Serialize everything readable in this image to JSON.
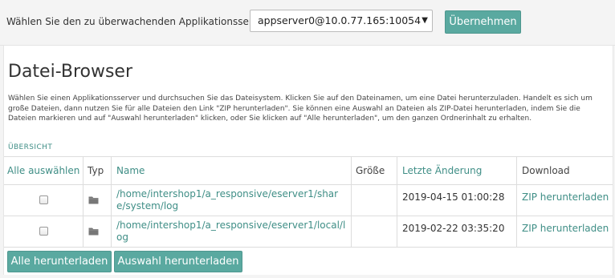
{
  "server_bar": {
    "label": "Wählen Sie den zu überwachenden Applikationsserver:",
    "selected_server": "appserver0@10.0.77.165:10054",
    "apply_label": "Übernehmen"
  },
  "page": {
    "title": "Datei-Browser",
    "description": "Wählen Sie einen Applikationsserver und durchsuchen Sie das Dateisystem. Klicken Sie auf den Dateinamen, um eine Datei herunterzuladen. Handelt es sich um große Dateien, dann nutzen Sie für alle Dateien den Link \"ZIP herunterladen\". Sie können eine Auswahl an Dateien als ZIP-Datei herunterladen, indem Sie die Dateien markieren und auf \"Auswahl herunterladen\" klicken, oder Sie klicken auf \"Alle herunterladen\", um den ganzen Ordnerinhalt zu erhalten.",
    "overview_link": "ÜBERSICHT"
  },
  "table": {
    "headers": {
      "select_all": "Alle auswählen",
      "type": "Typ",
      "name": "Name",
      "size": "Größe",
      "modified": "Letzte Änderung",
      "download": "Download"
    },
    "rows": [
      {
        "checked": false,
        "type_icon": "folder-icon",
        "name": "/home/intershop1/a_responsive/eserver1/share/system/log",
        "size": "",
        "modified": "2019-04-15 01:00:28",
        "download": "ZIP herunterladen"
      },
      {
        "checked": false,
        "type_icon": "folder-icon",
        "name": "/home/intershop1/a_responsive/eserver1/local/log",
        "size": "",
        "modified": "2019-02-22 03:35:20",
        "download": "ZIP herunterladen"
      }
    ]
  },
  "actions": {
    "download_all": "Alle herunterladen",
    "download_selection": "Auswahl herunterladen"
  },
  "colors": {
    "accent": "#5aa9a0",
    "link": "#3f8e86"
  }
}
